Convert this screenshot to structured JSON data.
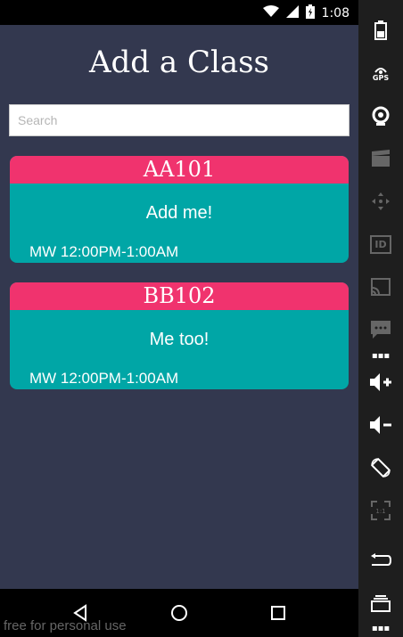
{
  "status_bar": {
    "time": "1:08"
  },
  "app": {
    "title": "Add a Class",
    "search": {
      "placeholder": "Search",
      "value": ""
    },
    "classes": [
      {
        "code": "AA101",
        "description": "Add me!",
        "schedule": "MW 12:00PM-1:00AM"
      },
      {
        "code": "BB102",
        "description": "Me too!",
        "schedule": "MW 12:00PM-1:00AM"
      }
    ]
  },
  "watermark": "free for personal use",
  "sidebar": {
    "gps_label": "GPS",
    "id_label": "ID"
  },
  "colors": {
    "background": "#33384f",
    "card_header": "#f0336e",
    "card_body": "#00a6a6"
  }
}
